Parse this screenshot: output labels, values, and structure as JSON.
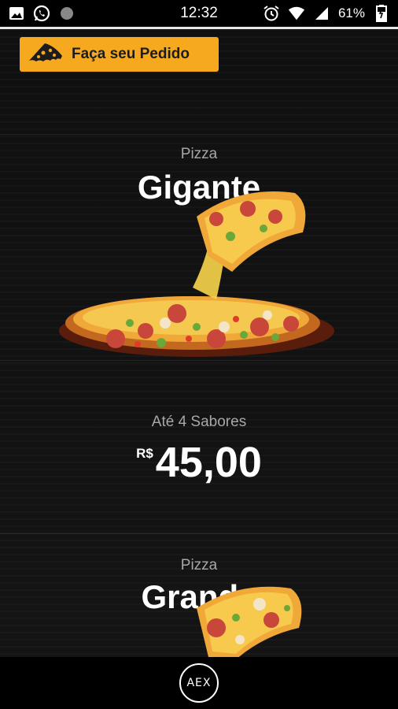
{
  "status_bar": {
    "time": "12:32",
    "battery": "61%",
    "icons_left": [
      "image-icon",
      "whatsapp-icon",
      "circle-icon"
    ],
    "icons_right": [
      "alarm-icon",
      "wifi-icon",
      "signal-icon",
      "battery-icon"
    ]
  },
  "header": {
    "order_button_label": "Faça seu Pedido",
    "order_button_icon": "pizza-slice-icon",
    "accent_color": "#f6a91e"
  },
  "products": [
    {
      "kind": "Pizza",
      "size": "Gigante",
      "flavors": "Até 4 Sabores",
      "currency": "R$",
      "price": "45,00"
    },
    {
      "kind": "Pizza",
      "size": "Grande"
    }
  ],
  "bottom_bar": {
    "logo_text": "AEX"
  }
}
